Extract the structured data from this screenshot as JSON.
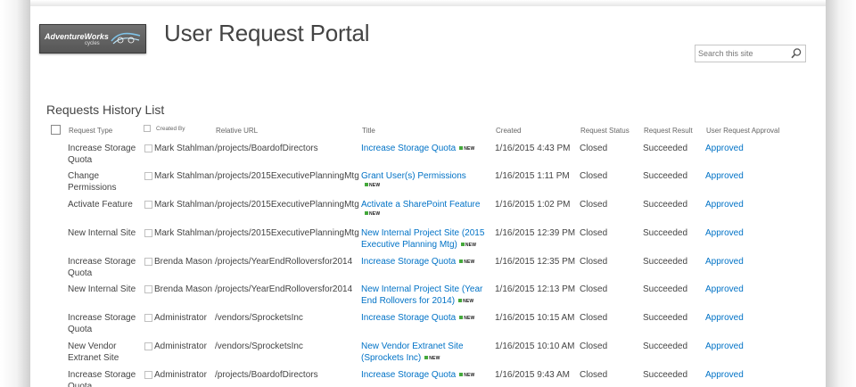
{
  "header": {
    "logo_name": "AdventureWorks",
    "logo_sub": "cycles",
    "site_title": "User Request Portal"
  },
  "search": {
    "placeholder": "Search this site"
  },
  "list": {
    "title": "Requests History List",
    "columns": {
      "request_type": "Request Type",
      "created_by": "Created By",
      "relative_url": "Relative URL",
      "title": "Title",
      "created": "Created",
      "request_status": "Request Status",
      "request_result": "Request Result",
      "user_request_approval": "User Request Approval"
    },
    "new_label": "NEW",
    "rows": [
      {
        "request_type": "Increase Storage Quota",
        "created_by": "Mark Stahlman",
        "relative_url": "/projects/BoardofDirectors",
        "title": "Increase Storage Quota",
        "created": "1/16/2015 4:43 PM",
        "status": "Closed",
        "result": "Succeeded",
        "approval": "Approved"
      },
      {
        "request_type": "Change Permissions",
        "created_by": "Mark Stahlman",
        "relative_url": "/projects/2015ExecutivePlanningMtg",
        "title": "Grant User(s) Permissions",
        "created": "1/16/2015 1:11 PM",
        "status": "Closed",
        "result": "Succeeded",
        "approval": "Approved"
      },
      {
        "request_type": "Activate Feature",
        "created_by": "Mark Stahlman",
        "relative_url": "/projects/2015ExecutivePlanningMtg",
        "title": "Activate a SharePoint Feature",
        "created": "1/16/2015 1:02 PM",
        "status": "Closed",
        "result": "Succeeded",
        "approval": "Approved"
      },
      {
        "request_type": "New Internal Site",
        "created_by": "Mark Stahlman",
        "relative_url": "/projects/2015ExecutivePlanningMtg",
        "title": "New Internal Project Site (2015 Executive Planning Mtg)",
        "created": "1/16/2015 12:39 PM",
        "status": "Closed",
        "result": "Succeeded",
        "approval": "Approved"
      },
      {
        "request_type": "Increase Storage Quota",
        "created_by": "Brenda Mason",
        "relative_url": "/projects/YearEndRolloversfor2014",
        "title": "Increase Storage Quota",
        "created": "1/16/2015 12:35 PM",
        "status": "Closed",
        "result": "Succeeded",
        "approval": "Approved"
      },
      {
        "request_type": "New Internal Site",
        "created_by": "Brenda Mason",
        "relative_url": "/projects/YearEndRolloversfor2014",
        "title": "New Internal Project Site (Year End Rollovers for 2014)",
        "created": "1/16/2015 12:13 PM",
        "status": "Closed",
        "result": "Succeeded",
        "approval": "Approved"
      },
      {
        "request_type": "Increase Storage Quota",
        "created_by": "Administrator",
        "relative_url": "/vendors/SprocketsInc",
        "title": "Increase Storage Quota",
        "created": "1/16/2015 10:15 AM",
        "status": "Closed",
        "result": "Succeeded",
        "approval": "Approved"
      },
      {
        "request_type": "New Vendor Extranet Site",
        "created_by": "Administrator",
        "relative_url": "/vendors/SprocketsInc",
        "title": "New Vendor Extranet Site (Sprockets Inc)",
        "created": "1/16/2015 10:10 AM",
        "status": "Closed",
        "result": "Succeeded",
        "approval": "Approved"
      },
      {
        "request_type": "Increase Storage Quota",
        "created_by": "Administrator",
        "relative_url": "/projects/BoardofDirectors",
        "title": "Increase Storage Quota",
        "created": "1/16/2015 9:43 AM",
        "status": "Closed",
        "result": "Succeeded",
        "approval": "Approved"
      }
    ]
  },
  "colors": {
    "link": "#0072c6",
    "text": "#444444",
    "new_badge": "#44a83b"
  },
  "icons": {
    "search_button": "magnifier-icon",
    "logo_mark": "bicycle-swoosh-icon"
  }
}
